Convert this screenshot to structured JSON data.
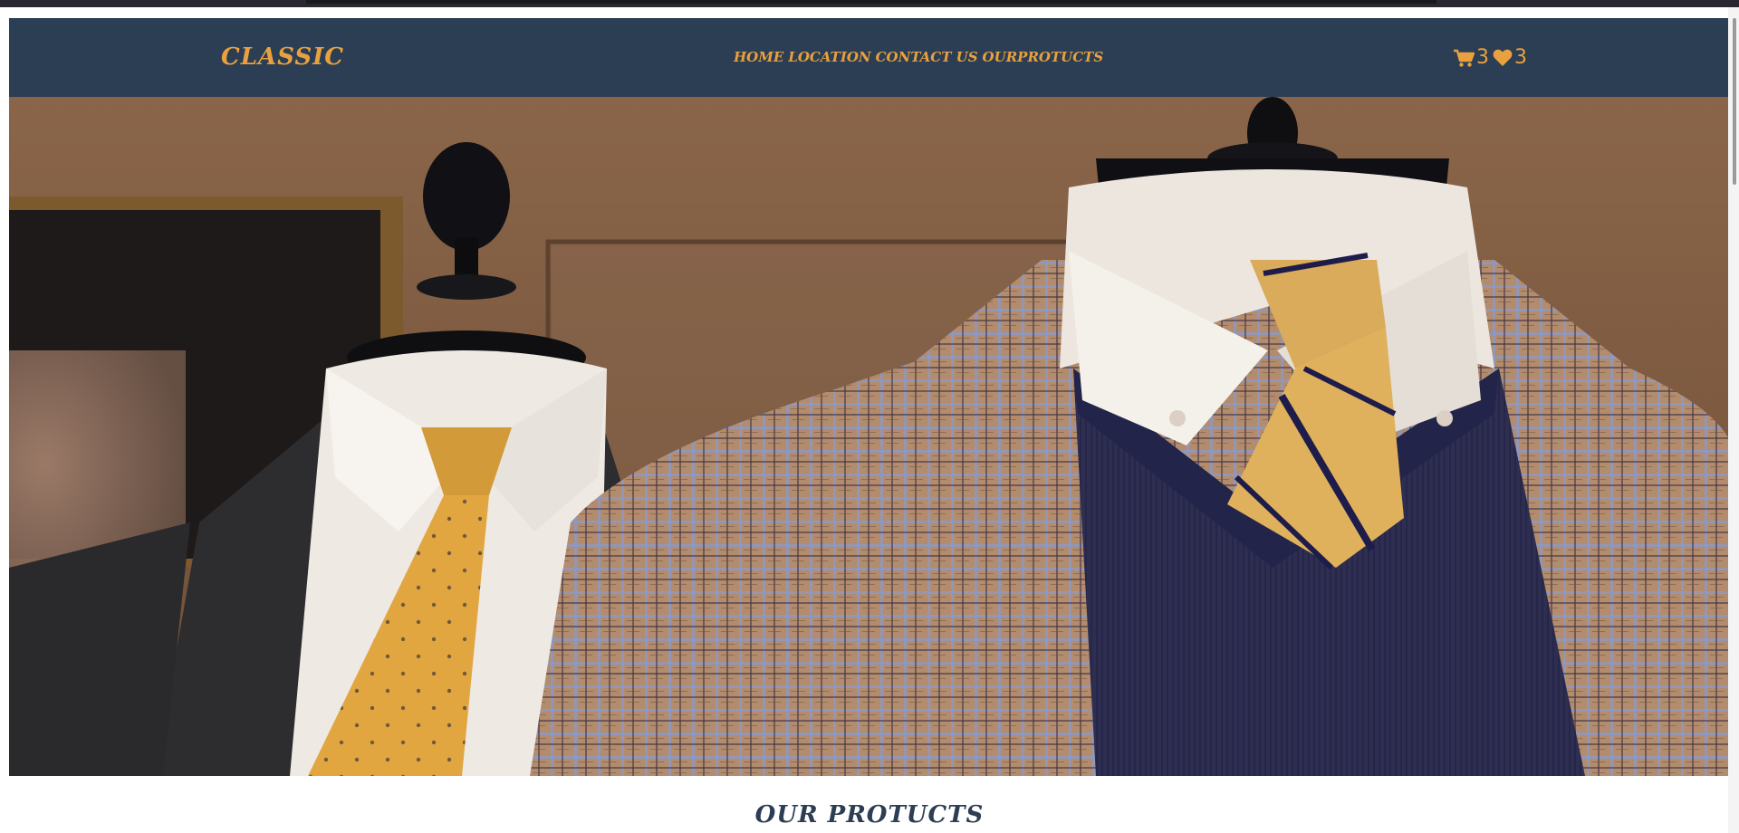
{
  "navbar": {
    "brand": "CLASSIC",
    "links": [
      "HOME",
      "LOCATION",
      "CONTACT US",
      "OURPROTUCTS"
    ],
    "cart_count": "3",
    "wishlist_count": "3"
  },
  "hero": {
    "icon": "suits-on-mannequins-photo"
  },
  "products": {
    "title": "OUR PROTUCTS"
  },
  "colors": {
    "navbar_bg": "#2c3e53",
    "accent": "#e9a13f"
  }
}
